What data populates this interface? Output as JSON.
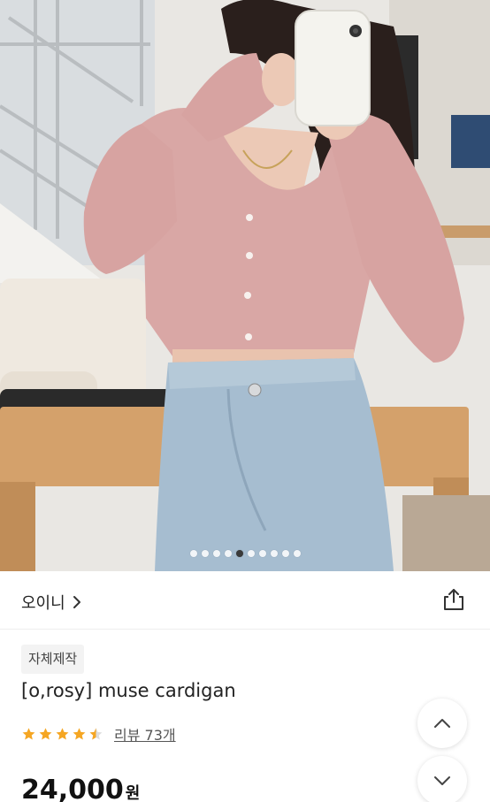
{
  "gallery": {
    "total_images": 10,
    "active_index": 5
  },
  "shop": {
    "name": "오이니"
  },
  "product": {
    "badge": "자체제작",
    "title": "[o,rosy] muse cardigan",
    "rating": 4.5,
    "review_label": "리뷰 73개",
    "price": "24,000",
    "currency": "원"
  },
  "colors": {
    "star": "#f5a623",
    "star_empty": "#dddddd",
    "text": "#222222"
  },
  "icons": {
    "shop_chevron": "chevron-right-icon",
    "share": "share-icon",
    "scroll_up": "chevron-up-icon",
    "scroll_down": "chevron-down-icon",
    "star": "star-icon"
  }
}
